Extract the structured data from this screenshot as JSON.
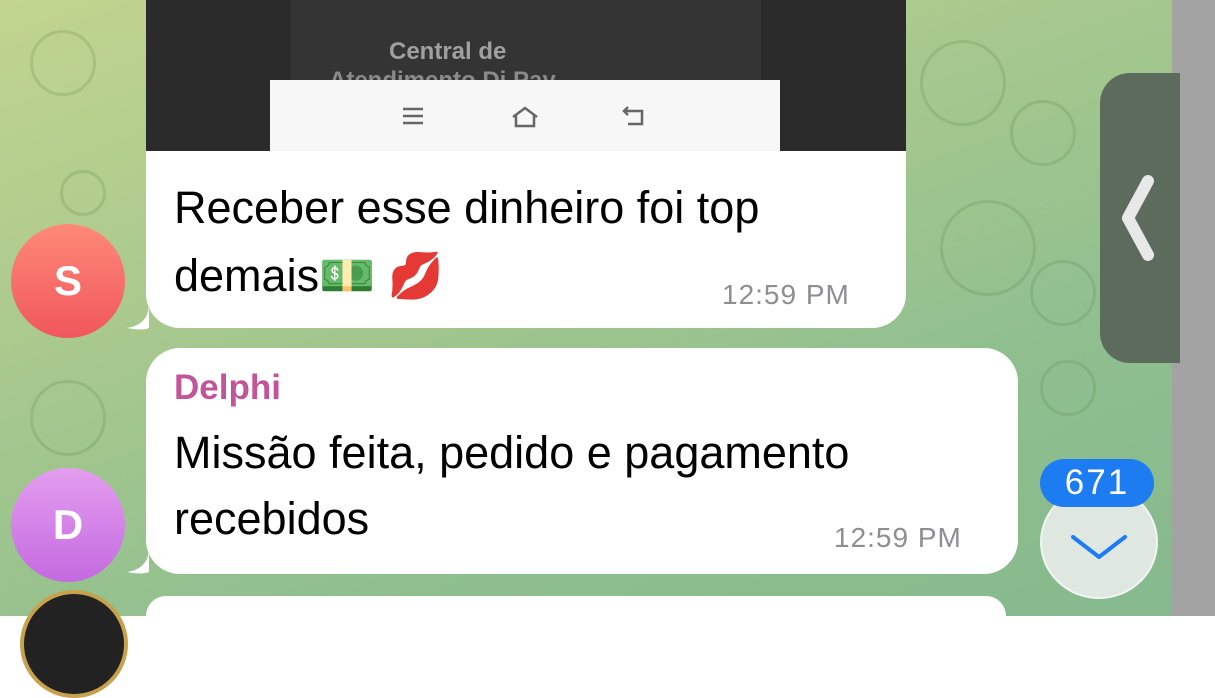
{
  "messages": [
    {
      "sender_initial": "S",
      "image": {
        "text_line1": "Central de",
        "text_line2": "Atendimento Di Pay"
      },
      "text_line1": "Receber esse dinheiro foi top",
      "text_line2": "demais💵 💋",
      "time": "12:59 PM"
    },
    {
      "sender_initial": "D",
      "sender_name": "Delphi",
      "text_line1": "Missão feita, pedido e pagamento",
      "text_line2": "recebidos",
      "time": "12:59 PM"
    }
  ],
  "scroll": {
    "unread_count": "671"
  },
  "icons": {
    "image_nav_menu": "menu-icon",
    "image_nav_home": "home-icon",
    "image_nav_back": "back-icon",
    "side_panel": "chevron-left-icon",
    "scroll_down": "chevron-down-icon"
  },
  "colors": {
    "sender_name": "#c2559a",
    "badge": "#1d7cf2",
    "avatar_s": "#f0565c",
    "avatar_d": "#c46ae0"
  }
}
